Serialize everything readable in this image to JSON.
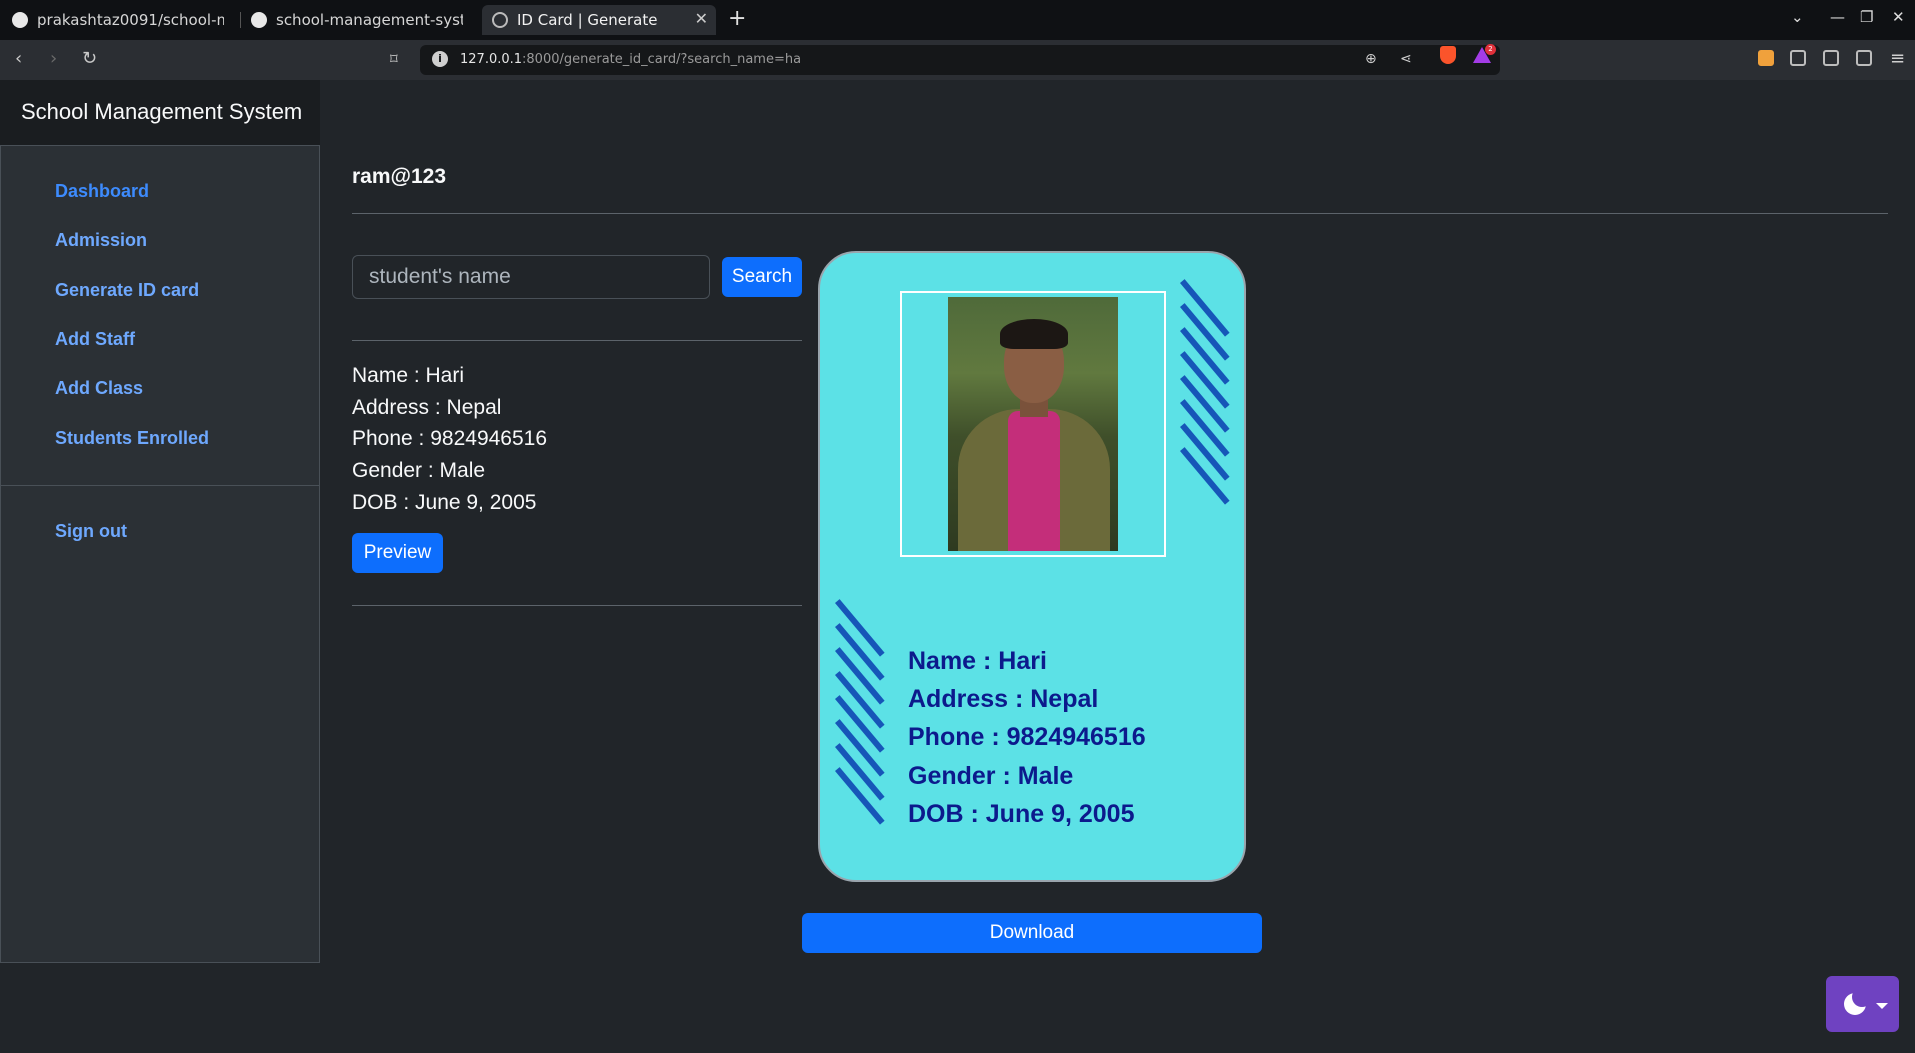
{
  "browser": {
    "tabs": [
      {
        "title": "prakashtaz0091/school-man"
      },
      {
        "title": "school-management-system"
      },
      {
        "title": "ID Card | Generate"
      }
    ],
    "new_tab": "+",
    "url_host": "127.0.0.1",
    "url_rest": ":8000/generate_id_card/?search_name=ha",
    "notification_count": "2"
  },
  "header": {
    "title": "School Management System"
  },
  "sidebar": {
    "items": [
      {
        "label": "Dashboard"
      },
      {
        "label": "Admission"
      },
      {
        "label": "Generate ID card"
      },
      {
        "label": "Add Staff"
      },
      {
        "label": "Add Class"
      },
      {
        "label": "Students Enrolled"
      }
    ],
    "signout": "Sign out"
  },
  "main": {
    "username": "ram@123",
    "search_placeholder": "student's name",
    "search_button": "Search",
    "student": {
      "name": "Name : Hari",
      "address": "Address : Nepal",
      "phone": "Phone : 9824946516",
      "gender": "Gender : Male",
      "dob": "DOB : June 9, 2005"
    },
    "preview_button": "Preview",
    "download_button": "Download"
  },
  "card": {
    "name": "Name : Hari",
    "address": "Address : Nepal",
    "phone": "Phone : 9824946516",
    "gender": "Gender : Male",
    "dob": "DOB : June 9, 2005"
  },
  "colors": {
    "accent": "#0d6efd",
    "card_bg": "#5ce1e6",
    "card_text": "#0c1a8c",
    "theme_toggle": "#6f42c1"
  }
}
